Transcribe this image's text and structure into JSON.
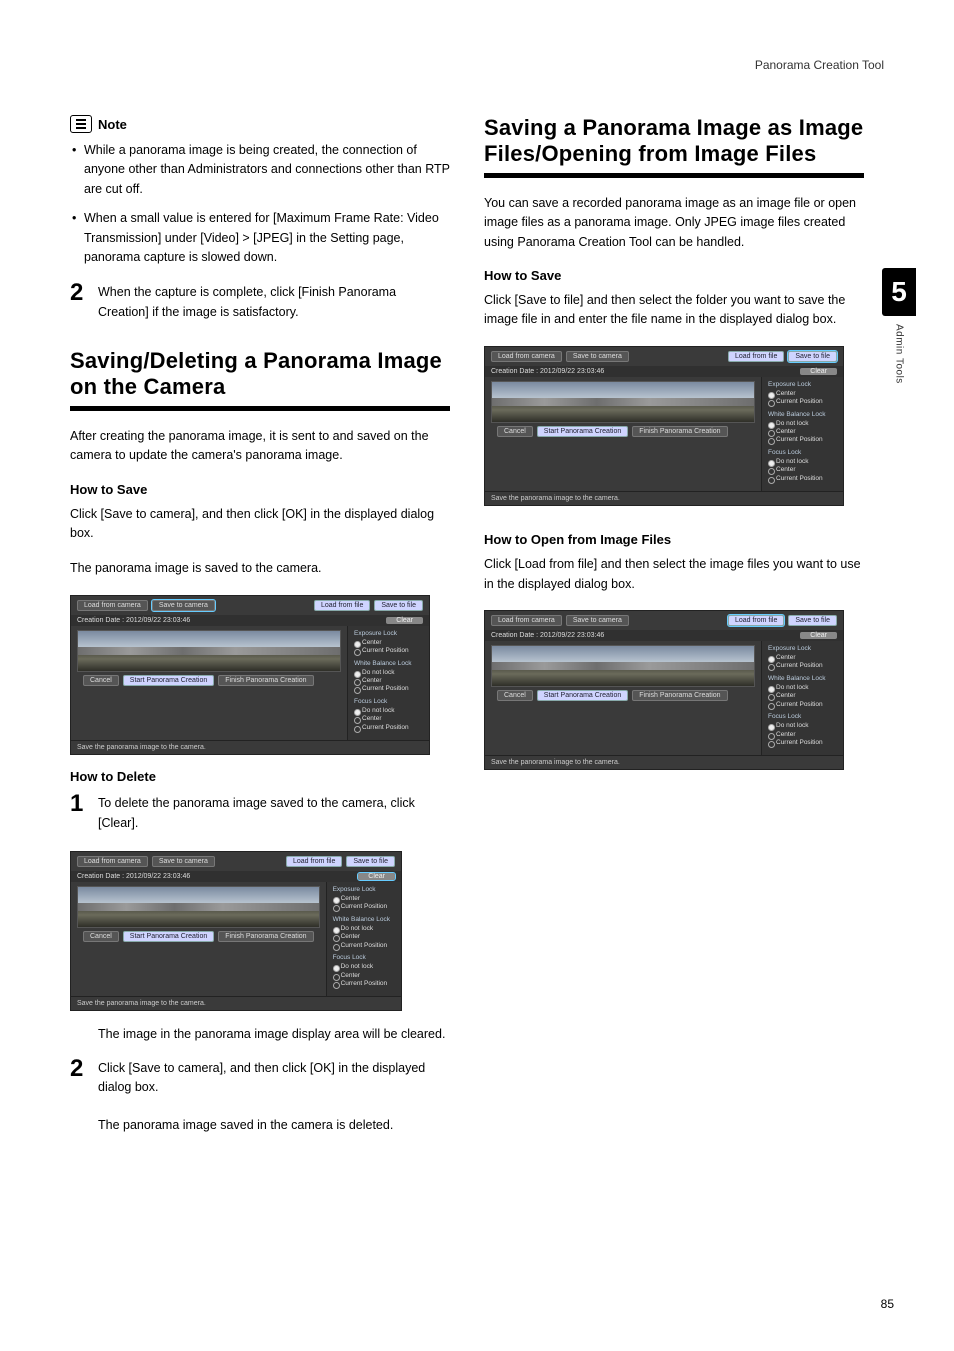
{
  "header": {
    "tool_name": "Panorama Creation Tool"
  },
  "sidetab": {
    "chapter": "5",
    "label": "Admin Tools"
  },
  "page_number": "85",
  "left": {
    "note_label": "Note",
    "bullets": [
      "While a panorama image is being created, the connection of anyone other than Administrators and connections other than RTP are cut off.",
      "When a small value is entered for [Maximum Frame Rate: Video Transmission] under [Video] > [JPEG] in the Setting page, panorama capture is slowed down."
    ],
    "step2_num": "2",
    "step2_text": "When the capture is complete, click [Finish Panorama Creation] if the image is satisfactory.",
    "h2": "Saving/Deleting a Panorama Image on the Camera",
    "intro": "After creating the panorama image, it is sent to and saved on the camera to update the camera's panorama image.",
    "how_save": "How to Save",
    "save_p1": "Click [Save to camera], and then click [OK] in the displayed dialog box.",
    "save_p2": "The panorama image is saved to the camera.",
    "how_delete": "How to Delete",
    "del_step1_num": "1",
    "del_step1_text": "To delete the panorama image saved to the camera, click [Clear].",
    "del_after1": "The image in the panorama image display area will be cleared.",
    "del_step2_num": "2",
    "del_step2_text": "Click [Save to camera], and then click [OK] in the displayed dialog box.",
    "del_after2": "The panorama image saved in the camera is deleted."
  },
  "right": {
    "h2": "Saving a Panorama Image as Image Files/Opening from Image Files",
    "intro": "You can save a recorded panorama image as an image file or open image files as a panorama image. Only JPEG image files created using Panorama Creation Tool can be handled.",
    "how_save": "How to Save",
    "save_p": "Click [Save to file] and then select the folder you want to save the image file in and enter the file name in the displayed dialog box.",
    "how_open": "How to Open from Image Files",
    "open_p": "Click [Load from file] and then select the image files you want to use in the displayed dialog box."
  },
  "shot": {
    "btn_load_cam": "Load from camera",
    "btn_save_cam": "Save to camera",
    "btn_load_file": "Load from file",
    "btn_save_file": "Save to file",
    "date": "Creation Date : 2012/09/22 23:03:46",
    "clear": "Clear",
    "grp1": "Exposure Lock",
    "grp2": "White Balance Lock",
    "grp3": "Focus Lock",
    "opt_nolock": "Do not lock",
    "opt_center": "Center",
    "opt_current": "Current Position",
    "cancel": "Cancel",
    "start": "Start Panorama Creation",
    "finish": "Finish Panorama Creation",
    "status": "Save the panorama image to the camera."
  }
}
